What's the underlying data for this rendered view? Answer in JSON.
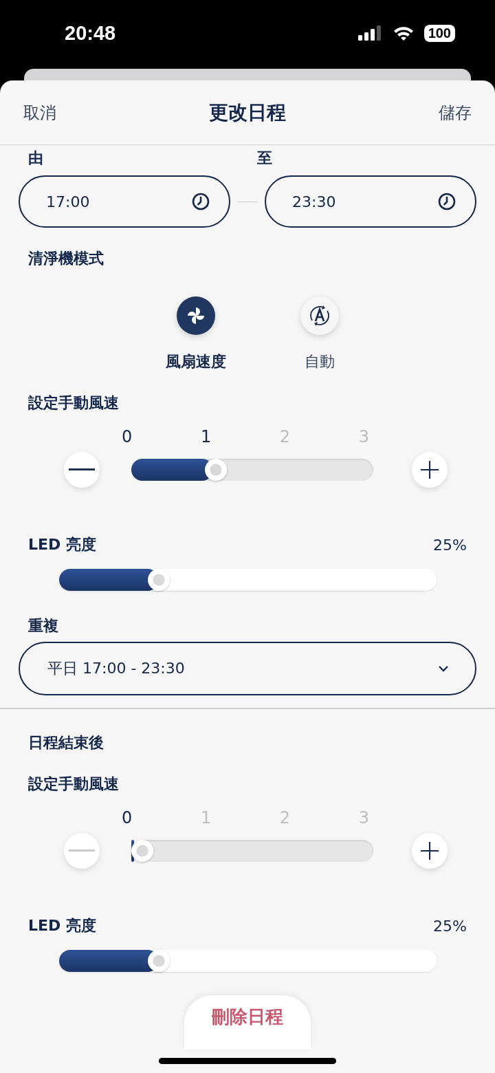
{
  "status_bar": {
    "time": "20:48",
    "battery": "100"
  },
  "header": {
    "cancel": "取消",
    "title": "更改日程",
    "save": "儲存"
  },
  "time_range": {
    "from_label": "由",
    "from_value": "17:00",
    "to_label": "至",
    "to_value": "23:30"
  },
  "mode": {
    "label": "清淨機模式",
    "options": [
      {
        "kind": "fan",
        "label": "風扇速度",
        "selected": true
      },
      {
        "kind": "auto",
        "label": "自動",
        "selected": false
      }
    ]
  },
  "sections": [
    {
      "kind": "speed",
      "label": "設定手動風速",
      "ticks": [
        "0",
        "1",
        "2",
        "3"
      ],
      "level": 0.3333,
      "minus_disabled": false
    },
    {
      "kind": "led",
      "label": "LED 亮度",
      "reading": "25%",
      "level": 0.25
    },
    {
      "kind": "repeat",
      "label": "重複",
      "value": "平日 17:00 - 23:30"
    },
    {
      "kind": "divider"
    },
    {
      "kind": "heading",
      "label": "日程結束後"
    },
    {
      "kind": "speed",
      "label": "設定手動風速",
      "ticks": [
        "0",
        "1",
        "2",
        "3"
      ],
      "level": 0,
      "minus_disabled": true
    },
    {
      "kind": "led",
      "label": "LED 亮度",
      "reading": "25%",
      "level": 0.25
    }
  ],
  "delete_button": "刪除日程"
}
